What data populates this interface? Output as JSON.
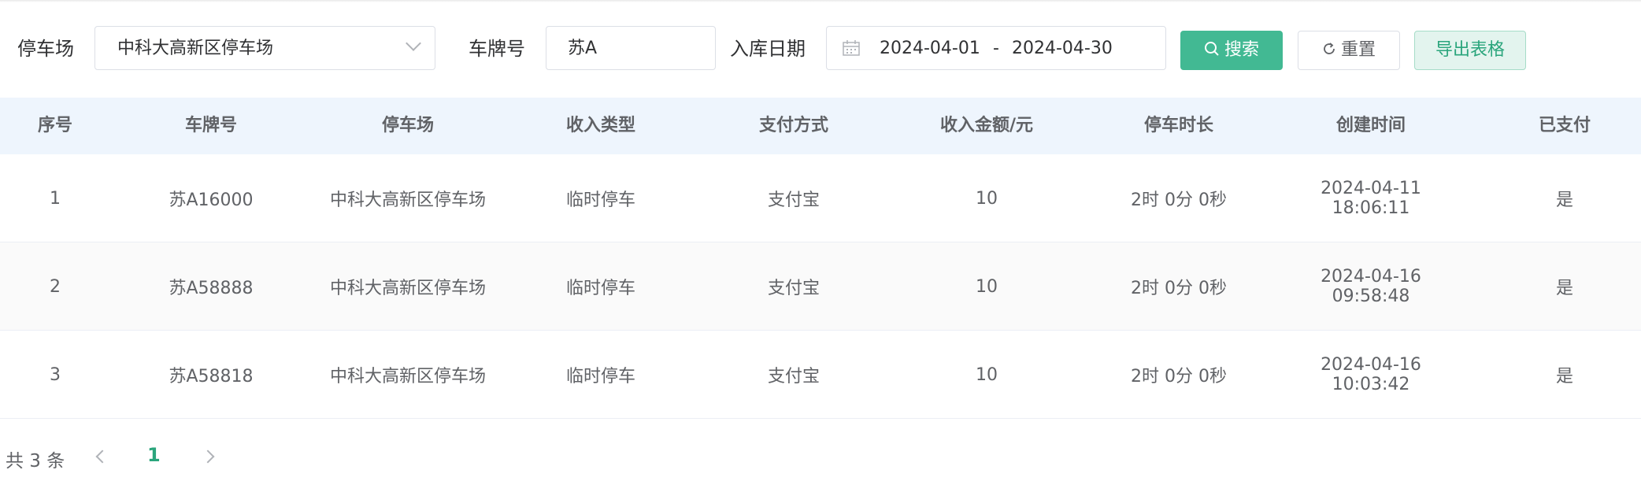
{
  "filters": {
    "parking_label": "停车场",
    "parking_value": "中科大高新区停车场",
    "plate_label": "车牌号",
    "plate_value": "苏A",
    "date_label": "入库日期",
    "date_start": "2024-04-01",
    "date_separator": "-",
    "date_end": "2024-04-30",
    "search_button": "搜索",
    "reset_button": "重置",
    "export_button": "导出表格",
    "icons": [
      "chevron-down-icon",
      "calendar-icon",
      "search-icon",
      "refresh-icon"
    ]
  },
  "table": {
    "columns": [
      "序号",
      "车牌号",
      "停车场",
      "收入类型",
      "支付方式",
      "收入金额/元",
      "停车时长",
      "创建时间",
      "已支付"
    ],
    "rows": [
      [
        "1",
        "苏A16000",
        "中科大高新区停车场",
        "临时停车",
        "支付宝",
        "10",
        "2时 0分 0秒",
        "2024-04-11 18:06:11",
        "是"
      ],
      [
        "2",
        "苏A58888",
        "中科大高新区停车场",
        "临时停车",
        "支付宝",
        "10",
        "2时 0分 0秒",
        "2024-04-16 09:58:48",
        "是"
      ],
      [
        "3",
        "苏A58818",
        "中科大高新区停车场",
        "临时停车",
        "支付宝",
        "10",
        "2时 0分 0秒",
        "2024-04-16 10:03:42",
        "是"
      ]
    ]
  },
  "pagination": {
    "total": "共 3 条",
    "current_page": "1"
  },
  "colors": {
    "accent": "#42b993",
    "header_bg": "#eef5fd"
  }
}
